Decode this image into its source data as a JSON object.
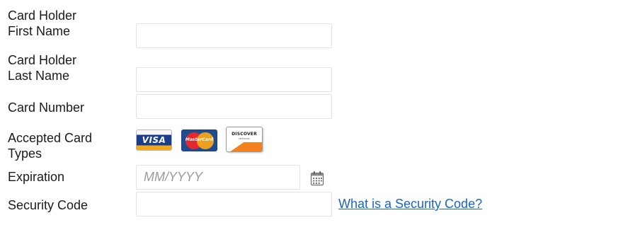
{
  "form": {
    "first_name": {
      "label_line1": "Card Holder",
      "label_line2": "First Name",
      "value": ""
    },
    "last_name": {
      "label_line1": "Card Holder",
      "label_line2": "Last Name",
      "value": ""
    },
    "card_number": {
      "label": "Card Number",
      "value": ""
    },
    "accepted_cards": {
      "label_line1": "Accepted Card",
      "label_line2": "Types",
      "cards": [
        {
          "name": "visa",
          "text": "VISA",
          "colors": [
            "#1a3d8c",
            "#f1a81a"
          ]
        },
        {
          "name": "mastercard",
          "text": "MasterCard",
          "colors": [
            "#e3282e",
            "#f6a51c",
            "#1e4c91"
          ]
        },
        {
          "name": "discover",
          "text": "DISCOVER",
          "subtext": "NETWORK",
          "colors": [
            "#f48120"
          ]
        }
      ]
    },
    "expiration": {
      "label": "Expiration",
      "placeholder": "MM/YYYY",
      "value": "",
      "icon": "calendar-icon"
    },
    "security_code": {
      "label": "Security Code",
      "value": "",
      "help_link": "What is a Security Code?"
    }
  },
  "colors": {
    "link": "#1a64c9",
    "border": "#e3e3e3",
    "text": "#1a1a1a",
    "placeholder": "#9a9a9a"
  }
}
